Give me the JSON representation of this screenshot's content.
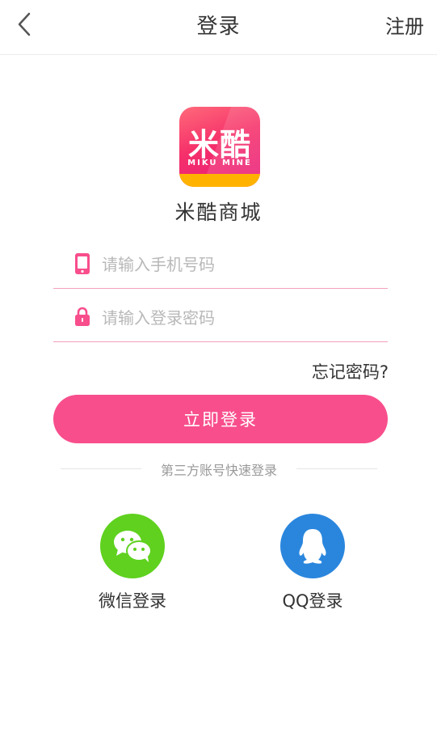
{
  "nav": {
    "title": "登录",
    "register": "注册",
    "back_icon": "chevron-left-icon"
  },
  "brand": {
    "logo_cn": "米酷",
    "logo_en": "MIKU MINE",
    "app_name": "米酷商城",
    "colors": {
      "primary": "#f84e8c",
      "logo_band": "#ffb300"
    }
  },
  "form": {
    "phone_placeholder": "请输入手机号码",
    "password_placeholder": "请输入登录密码",
    "phone_value": "",
    "password_value": "",
    "forgot": "忘记密码?",
    "submit": "立即登录"
  },
  "third_party": {
    "divider": "第三方账号快速登录",
    "wechat": {
      "label": "微信登录",
      "color": "#5fd11e",
      "icon": "wechat-icon"
    },
    "qq": {
      "label": "QQ登录",
      "color": "#2a86dd",
      "icon": "qq-icon"
    }
  }
}
